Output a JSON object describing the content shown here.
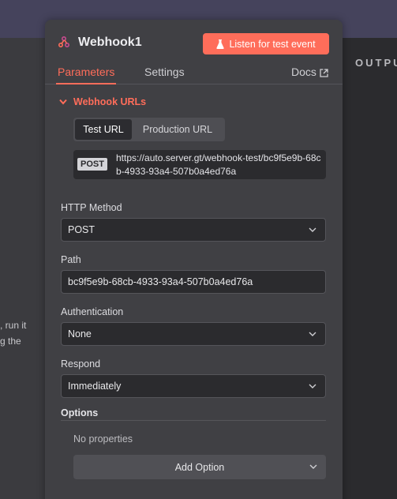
{
  "left_hint_lines": [
    ", run it",
    "g the"
  ],
  "output_label": "OUTPU",
  "node": {
    "title": "Webhook1",
    "icon": "webhook-icon"
  },
  "listen_button": {
    "label": "Listen for test event",
    "icon": "flask-icon"
  },
  "tabs": [
    {
      "label": "Parameters",
      "active": true
    },
    {
      "label": "Settings",
      "active": false
    }
  ],
  "docs": {
    "label": "Docs",
    "icon": "external-link-icon"
  },
  "webhook_urls": {
    "section_label": "Webhook URLs",
    "toggle_icon": "chevron-down-icon",
    "url_tabs": [
      {
        "label": "Test URL",
        "active": true
      },
      {
        "label": "Production URL",
        "active": false
      }
    ],
    "method": "POST",
    "url": "https://auto.server.gt/webhook-test/bc9f5e9b-68cb-4933-93a4-507b0a4ed76a"
  },
  "fields": {
    "http_method": {
      "label": "HTTP Method",
      "value": "POST"
    },
    "path": {
      "label": "Path",
      "value": "bc9f5e9b-68cb-4933-93a4-507b0a4ed76a"
    },
    "authentication": {
      "label": "Authentication",
      "value": "None"
    },
    "respond": {
      "label": "Respond",
      "value": "Immediately"
    }
  },
  "options": {
    "title": "Options",
    "empty_text": "No properties",
    "add_button": "Add Option"
  },
  "colors": {
    "accent": "#ff6d5a",
    "panel_bg": "#404044",
    "field_bg": "#2b2b2e",
    "topbar": "#45435c"
  }
}
